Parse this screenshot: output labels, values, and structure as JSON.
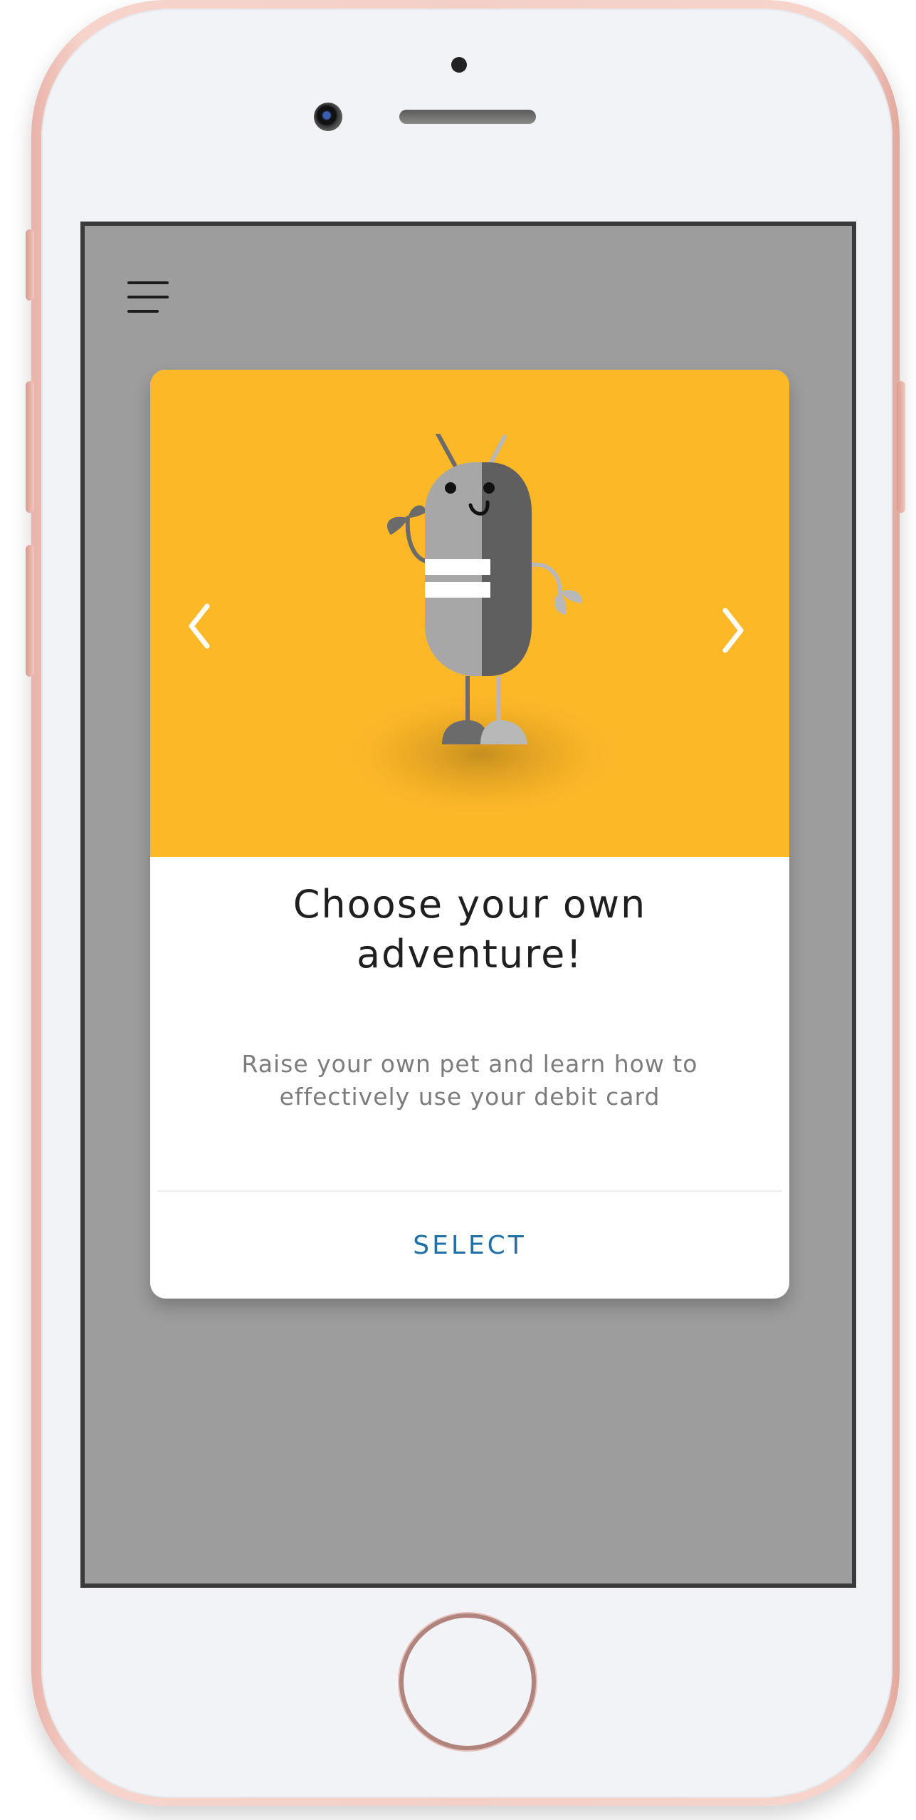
{
  "app": {
    "menu_icon": "hamburger-menu-icon"
  },
  "card": {
    "title_line1": "Choose your own",
    "title_line2": "adventure!",
    "description_line1": "Raise your own pet and learn how to",
    "description_line2": "effectively use your debit card",
    "select_label": "SELECT",
    "prev_icon": "chevron-left-icon",
    "next_icon": "chevron-right-icon",
    "pet_illustration": "robot-pet-illustration"
  },
  "colors": {
    "hero_background": "#fdb828",
    "screen_overlay": "#9d9d9d",
    "accent": "#1f6fa8",
    "title_text": "#1f1f1f",
    "description_text": "#7c7c7c",
    "phone_frame": "#f3cfc7"
  }
}
